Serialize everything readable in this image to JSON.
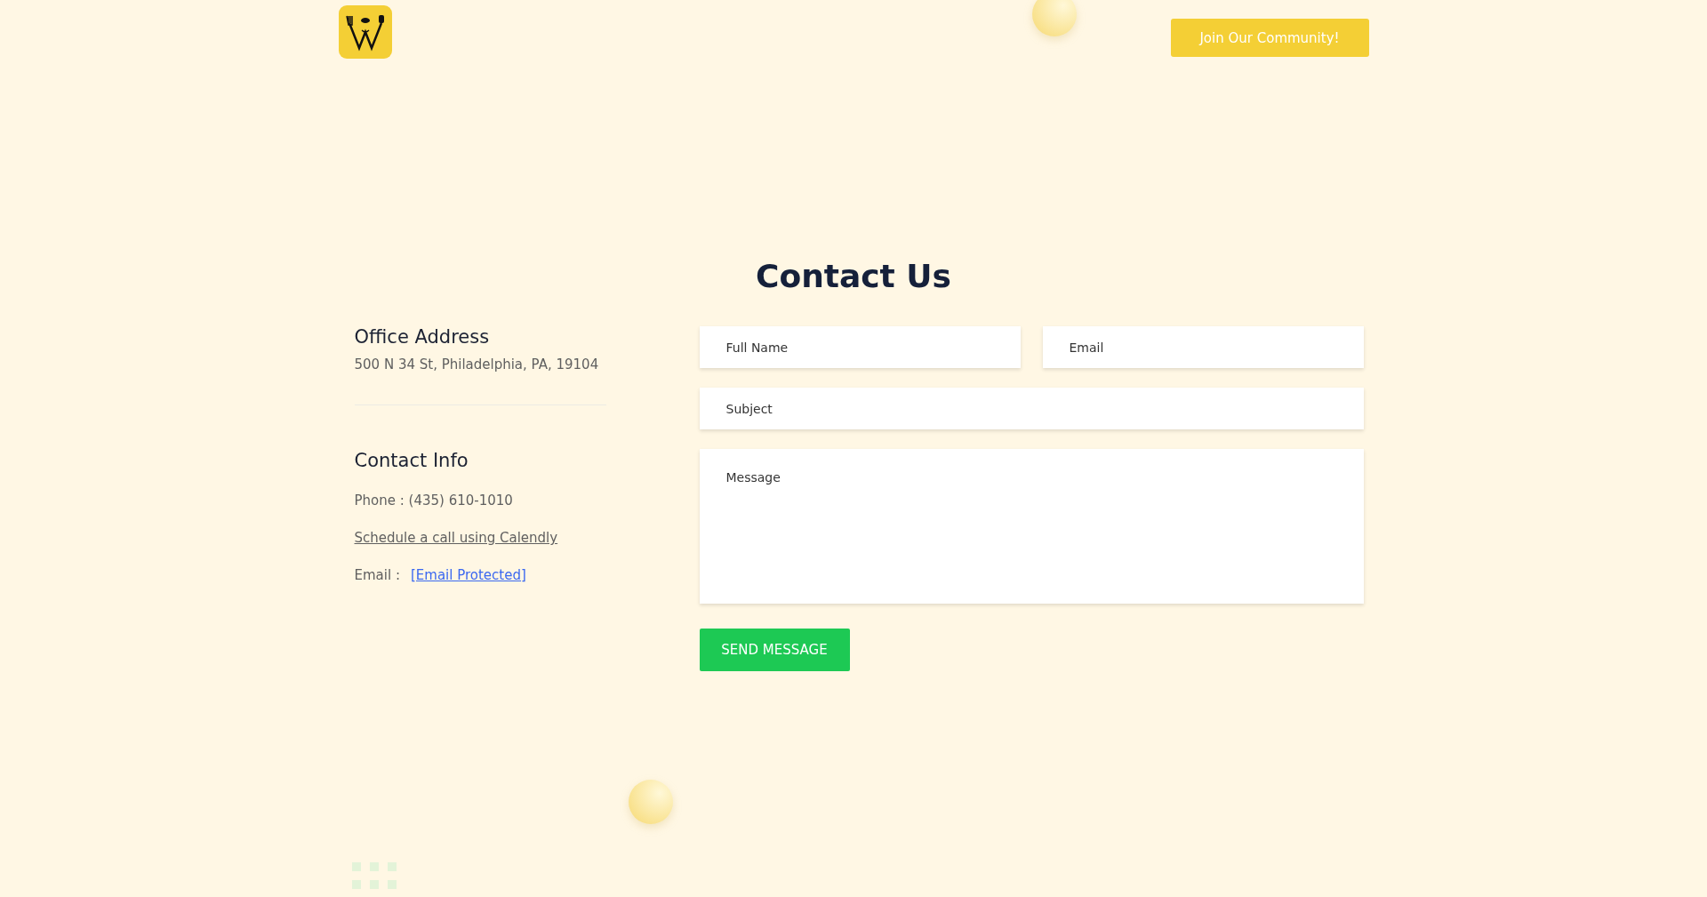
{
  "header": {
    "cta_button": "Join Our Community!"
  },
  "title": "Contact Us",
  "office": {
    "heading": "Office Address",
    "address": "500 N 34 St, Philadelphia, PA, 19104"
  },
  "contact_info": {
    "heading": "Contact Info",
    "phone": "Phone : (435) 610-1010",
    "schedule_link": "Schedule a call using Calendly",
    "email_label": "Email :",
    "email_link": "[Email Protected]"
  },
  "form": {
    "full_name": {
      "placeholder": "Full Name"
    },
    "email": {
      "placeholder": "Email"
    },
    "subject": {
      "placeholder": "Subject"
    },
    "message": {
      "placeholder": "Message"
    },
    "submit": "SEND MESSAGE"
  }
}
